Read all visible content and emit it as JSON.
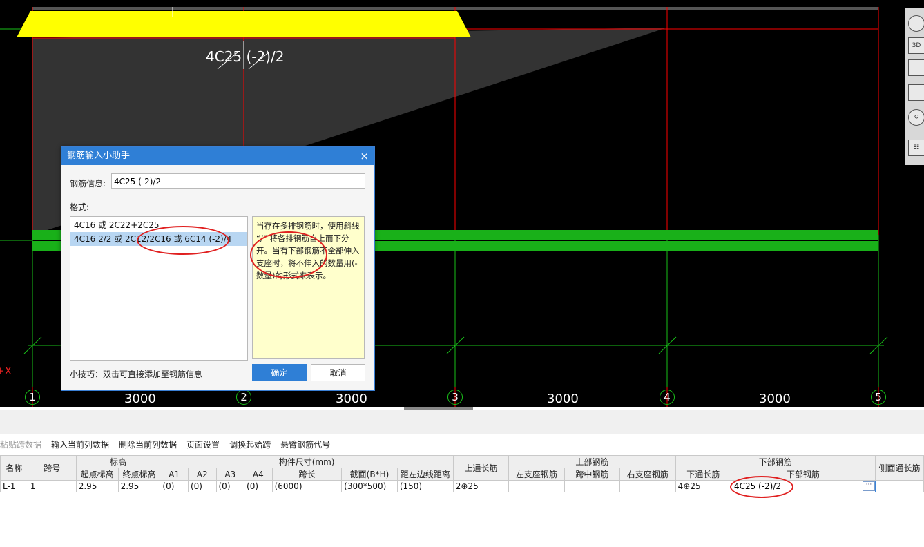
{
  "canvas": {
    "beam_label": "4C25 (-2)/2",
    "axis_numbers": [
      "1",
      "2",
      "3",
      "4",
      "5"
    ],
    "span_lengths": [
      "3000",
      "3000",
      "3000",
      "3000"
    ],
    "x_axis_label": "+X",
    "colors": {
      "background": "#000000",
      "grid_red": "#ff0000",
      "grid_green": "#19c019",
      "beam_yellow": "#ffff00",
      "beam_green": "#19b019"
    }
  },
  "right_toolbar": {
    "icons": [
      "sphere-view-icon",
      "3d-view-icon",
      "top-view-icon",
      "box-view-icon",
      "rotate-icon",
      "layers-icon"
    ],
    "label_3d": "3D"
  },
  "toolbar": {
    "paste_span": "粘贴跨数据",
    "input_column": "输入当前列数据",
    "delete_column": "删除当前列数据",
    "page_setup": "页面设置",
    "swap_start": "调换起始跨",
    "cantilever": "悬臂钢筋代号"
  },
  "grid": {
    "headers_top": {
      "name": "名称",
      "span_no": "跨号",
      "elevation": "标高",
      "dimensions": "构件尺寸(mm)",
      "top_through": "上通长筋",
      "top_rebar": "上部钢筋",
      "bottom_rebar": "下部钢筋",
      "side_through": "侧面通长筋"
    },
    "headers_sub": {
      "start_elev": "起点标高",
      "end_elev": "终点标高",
      "a1": "A1",
      "a2": "A2",
      "a3": "A3",
      "a4": "A4",
      "span_len": "跨长",
      "section": "截面(B*H)",
      "left_dist": "距左边线距离",
      "left_support": "左支座钢筋",
      "mid_span": "跨中钢筋",
      "right_support": "右支座钢筋",
      "bottom_through": "下通长筋",
      "bottom_rebar": "下部钢筋"
    },
    "row": {
      "name": "L-1",
      "span_no": "1",
      "start_elev": "2.95",
      "end_elev": "2.95",
      "a1": "(0)",
      "a2": "(0)",
      "a3": "(0)",
      "a4": "(0)",
      "span_len": "(6000)",
      "section": "(300*500)",
      "left_dist": "(150)",
      "top_through": "2⊕25",
      "left_support": "",
      "mid_span": "",
      "right_support": "",
      "bottom_through": "4⊕25",
      "bottom_rebar": "4C25 (-2)/2",
      "dots": "···"
    }
  },
  "dialog": {
    "title": "钢筋输入小助手",
    "close": "×",
    "info_label": "钢筋信息:",
    "info_value": "4C25 (-2)/2",
    "format_label": "格式:",
    "formats": [
      "4C16 或 2C22+2C25",
      "4C16 2/2 或 2C12/2C16 或 6C14 (-2)/4"
    ],
    "help_text": "当存在多排钢筋时，使用斜线 “/” 将各排钢筋自上而下分开。当有下部钢筋不全部伸入支座时，将不伸入的数量用(-数量)的形式来表示。",
    "tip": "小技巧：双击可直接添加至钢筋信息",
    "ok": "确定",
    "cancel": "取消"
  }
}
